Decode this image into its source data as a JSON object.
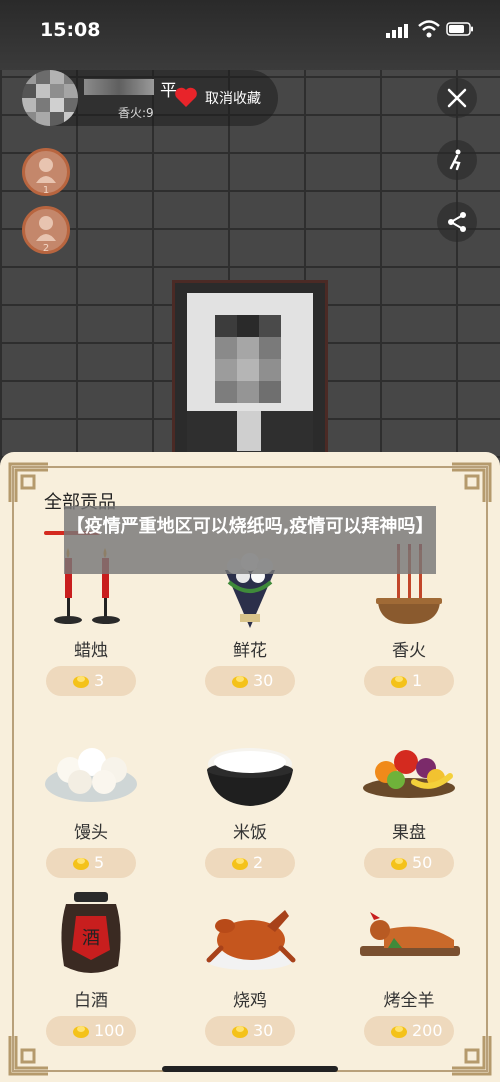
{
  "status_bar": {
    "time": "15:08"
  },
  "user": {
    "name_suffix": "平",
    "subtitle": "香火:9",
    "unfavorite_label": "取消收藏"
  },
  "ranking": [
    "1",
    "2"
  ],
  "offerings": {
    "title": "全部贡品",
    "items": [
      {
        "name": "蜡烛",
        "price": "3"
      },
      {
        "name": "鲜花",
        "price": "30"
      },
      {
        "name": "香火",
        "price": "1"
      },
      {
        "name": "馒头",
        "price": "5"
      },
      {
        "name": "米饭",
        "price": "2"
      },
      {
        "name": "果盘",
        "price": "50"
      },
      {
        "name": "白酒",
        "price": "100"
      },
      {
        "name": "烧鸡",
        "price": "30"
      },
      {
        "name": "烤全羊",
        "price": "200"
      }
    ]
  },
  "headline": "【疫情严重地区可以烧纸吗,疫情可以拜神吗】",
  "colors": {
    "accent_red": "#d42a1f",
    "panel_bg": "#f8efdc",
    "price_pill": "#eed9bd",
    "coin": "#f4c21a"
  }
}
